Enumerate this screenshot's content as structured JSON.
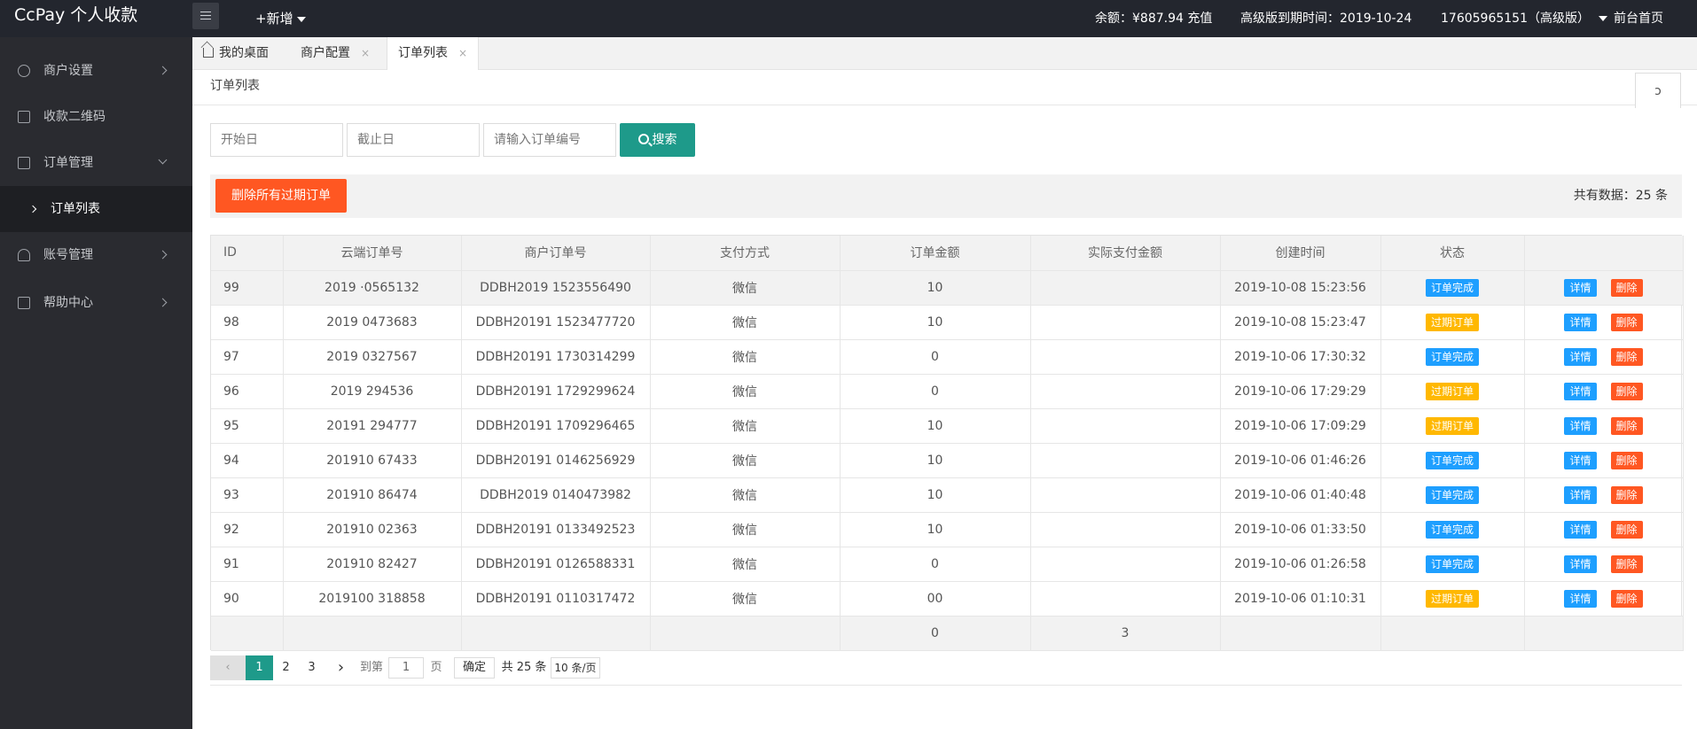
{
  "topbar": {
    "logo": "CcPay 个人收款",
    "new_label": "+新增",
    "balance": "余额：¥887.94 充值",
    "expiry": "高级版到期时间：2019-10-24",
    "account": "17605965151（高级版）",
    "front_home": "前台首页"
  },
  "sidebar": {
    "items": [
      {
        "label": "商户设置"
      },
      {
        "label": "收款二维码"
      },
      {
        "label": "订单管理"
      },
      {
        "label": "订单列表"
      },
      {
        "label": "账号管理"
      },
      {
        "label": "帮助中心"
      }
    ]
  },
  "tabs": {
    "home": "我的桌面",
    "merchant": "商户配置",
    "orders": "订单列表",
    "close": "×"
  },
  "breadcrumb": "订单列表",
  "refresh_icon": "ↄ",
  "search": {
    "start_placeholder": "开始日",
    "end_placeholder": "截止日",
    "order_placeholder": "请输入订单编号",
    "button": "搜索"
  },
  "actions": {
    "delete_all": "删除所有过期订单",
    "total": "共有数据：25 条"
  },
  "table": {
    "headers": [
      "ID",
      "云端订单号",
      "商户订单号",
      "支付方式",
      "订单金额",
      "实际支付金额",
      "创建时间",
      "状态",
      ""
    ],
    "rows": [
      {
        "id": "99",
        "cloud": "2019 ·0565132",
        "merchant": "DDBH2019 1523556490",
        "pay": "微信",
        "amount": "10",
        "actual": "",
        "time": "2019-10-08 15:23:56",
        "status": "订单完成"
      },
      {
        "id": "98",
        "cloud": "2019 0473683",
        "merchant": "DDBH20191 1523477720",
        "pay": "微信",
        "amount": "10",
        "actual": "",
        "time": "2019-10-08 15:23:47",
        "status": "过期订单"
      },
      {
        "id": "97",
        "cloud": "2019 0327567",
        "merchant": "DDBH20191 1730314299",
        "pay": "微信",
        "amount": "0",
        "actual": "",
        "time": "2019-10-06 17:30:32",
        "status": "订单完成"
      },
      {
        "id": "96",
        "cloud": "2019 294536",
        "merchant": "DDBH20191 1729299624",
        "pay": "微信",
        "amount": "0",
        "actual": "",
        "time": "2019-10-06 17:29:29",
        "status": "过期订单"
      },
      {
        "id": "95",
        "cloud": "20191 294777",
        "merchant": "DDBH20191 1709296465",
        "pay": "微信",
        "amount": "10",
        "actual": "",
        "time": "2019-10-06 17:09:29",
        "status": "过期订单"
      },
      {
        "id": "94",
        "cloud": "201910 67433",
        "merchant": "DDBH20191 0146256929",
        "pay": "微信",
        "amount": "10",
        "actual": "",
        "time": "2019-10-06 01:46:26",
        "status": "订单完成"
      },
      {
        "id": "93",
        "cloud": "201910 86474",
        "merchant": "DDBH2019 0140473982",
        "pay": "微信",
        "amount": "10",
        "actual": "",
        "time": "2019-10-06 01:40:48",
        "status": "订单完成"
      },
      {
        "id": "92",
        "cloud": "201910 02363",
        "merchant": "DDBH20191 0133492523",
        "pay": "微信",
        "amount": "10",
        "actual": "",
        "time": "2019-10-06 01:33:50",
        "status": "订单完成"
      },
      {
        "id": "91",
        "cloud": "201910 82427",
        "merchant": "DDBH20191 0126588331",
        "pay": "微信",
        "amount": "0",
        "actual": "",
        "time": "2019-10-06 01:26:58",
        "status": "订单完成"
      },
      {
        "id": "90",
        "cloud": "2019100 318858",
        "merchant": "DDBH20191 0110317472",
        "pay": "微信",
        "amount": "00",
        "actual": "",
        "time": "2019-10-06 01:10:31",
        "status": "过期订单"
      }
    ],
    "footer": {
      "amount_total": "0",
      "actual_total": "3"
    },
    "detail_label": "详情",
    "delete_label": "删除"
  },
  "colors": {
    "complete": "#1e9fff",
    "expired": "#ffb800",
    "danger": "#ff5722",
    "primary": "#1e9a8a"
  },
  "pagination": {
    "prev": "‹",
    "pages": [
      "1",
      "2",
      "3"
    ],
    "next": "›",
    "goto_label": "到第",
    "goto_value": "1",
    "page_unit": "页",
    "confirm": "确定",
    "total": "共 25 条",
    "per_page": "10 条/页"
  }
}
